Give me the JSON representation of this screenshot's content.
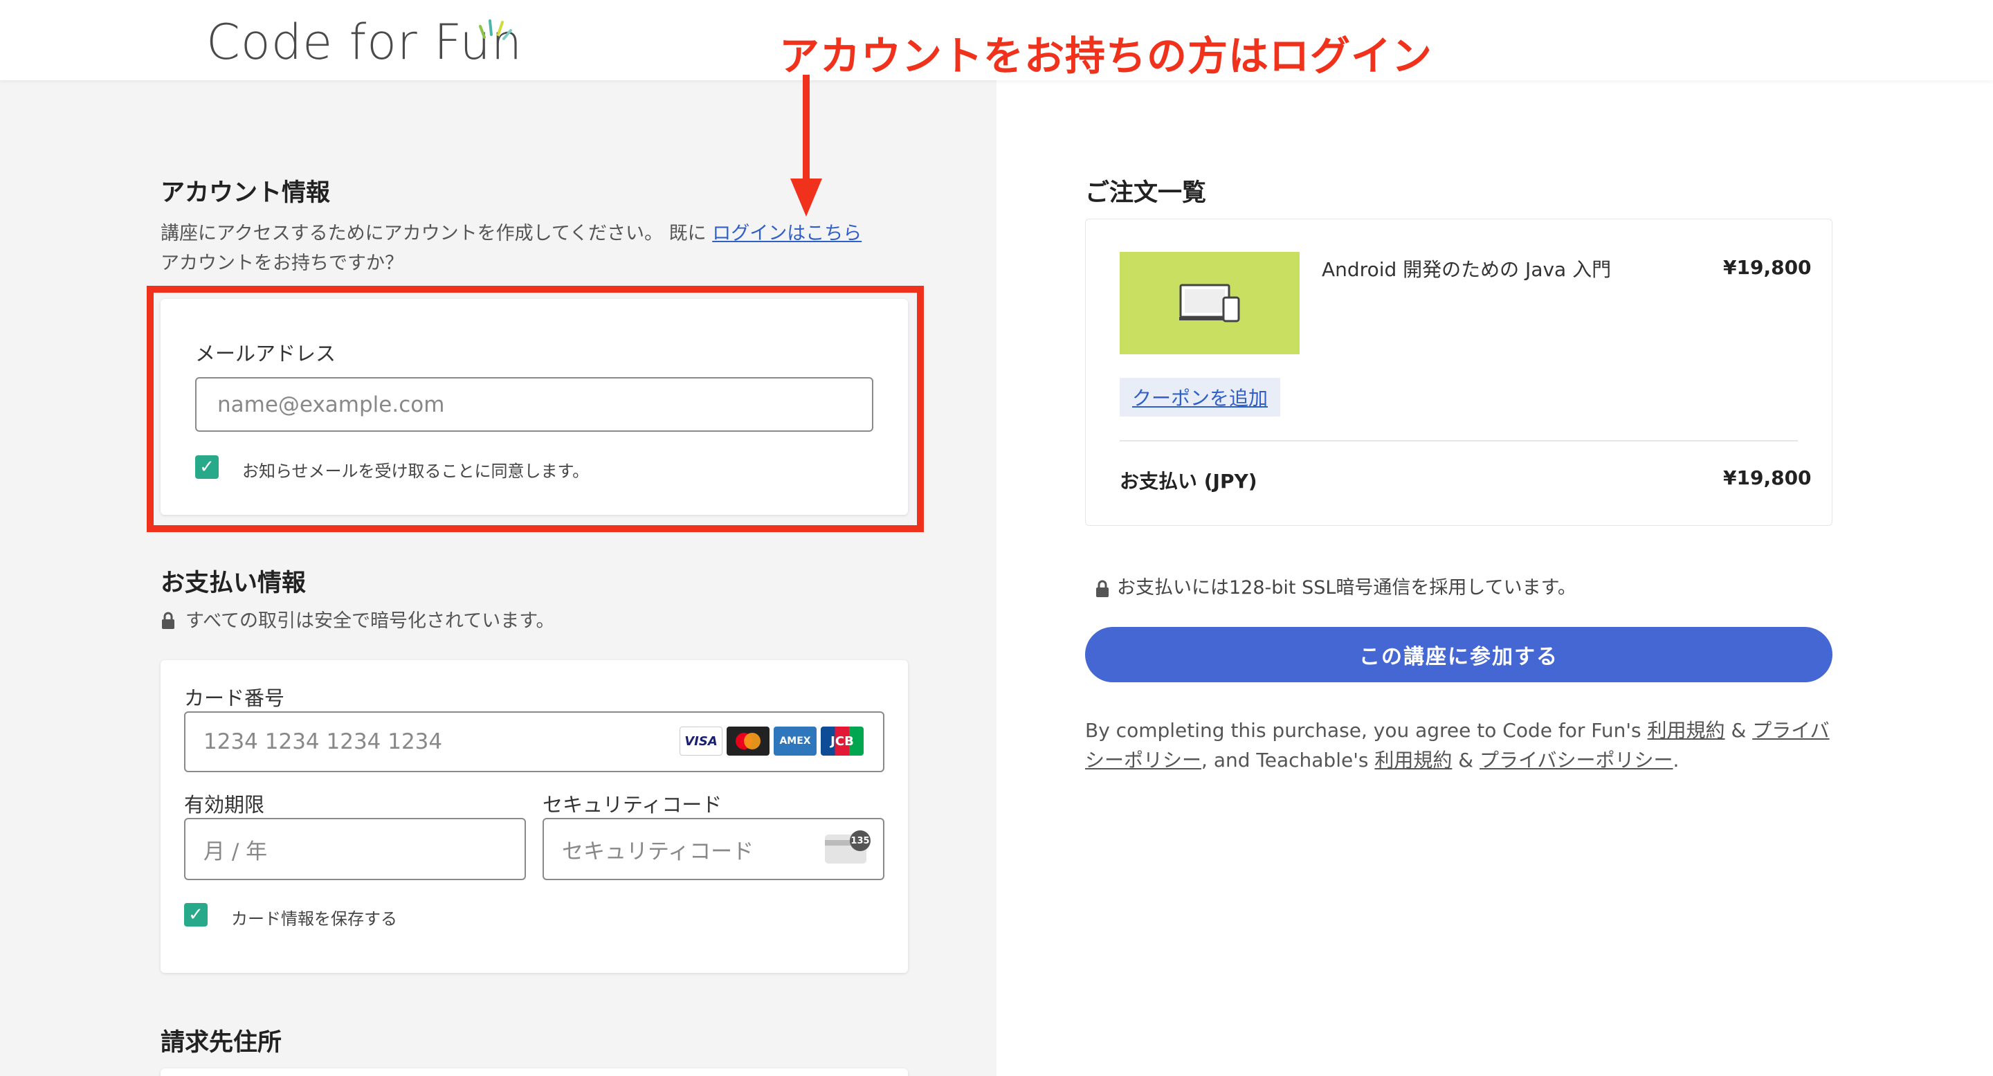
{
  "header": {
    "logo_text": "Code for Fun"
  },
  "annotation": {
    "text": "アカウントをお持ちの方はログイン",
    "color": "#f0321c"
  },
  "account": {
    "title": "アカウント情報",
    "desc_prefix": "講座にアクセスするためにアカウントを作成してください。 既に",
    "desc_link": "ログインはこちら",
    "desc_suffix": "アカウントをお持ちですか？",
    "email_label": "メールアドレス",
    "email_placeholder": "name@example.com",
    "newsletter_label": "お知らせメールを受け取ることに同意します。",
    "newsletter_checked": true
  },
  "payment": {
    "title": "お支払い情報",
    "secure_note": "すべての取引は安全で暗号化されています。",
    "card_number_label": "カード番号",
    "card_number_placeholder": "1234 1234 1234 1234",
    "card_brands": [
      "VISA",
      "Mastercard",
      "AMEX",
      "JCB"
    ],
    "expiry_label": "有効期限",
    "expiry_placeholder": "月 / 年",
    "cvc_label": "セキュリティコード",
    "cvc_placeholder": "セキュリティコード",
    "cvc_badge": "135",
    "save_card_label": "カード情報を保存する",
    "save_card_checked": true
  },
  "billing": {
    "title": "請求先住所"
  },
  "order": {
    "title": "ご注文一覧",
    "product_name": "Android 開発のための Java 入門",
    "product_price": "¥19,800",
    "coupon_label": "クーポンを追加",
    "total_label": "お支払い (JPY)",
    "total_price": "¥19,800",
    "ssl_note": "お支払いには128-bit SSL暗号通信を採用しています。",
    "submit_label": "この講座に参加する",
    "thumbnail_color": "#c9df61",
    "accent_color": "#4467d3"
  },
  "legal": {
    "prefix": "By completing this purchase, you agree to Code for Fun's ",
    "terms1": "利用規約",
    "amp1": " & ",
    "privacy1": "プライバシーポリシー",
    "mid": ", and Teachable's ",
    "terms2": "利用規約",
    "amp2": " & ",
    "privacy2": "プライバシーポリシー",
    "end": "."
  }
}
